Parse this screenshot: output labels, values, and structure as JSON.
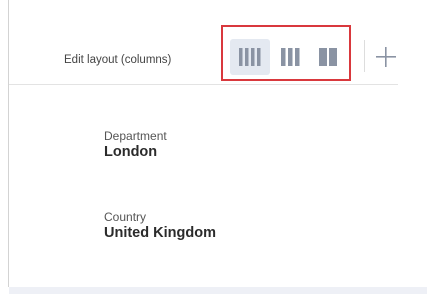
{
  "toolbar": {
    "edit_layout_label": "Edit layout (columns)",
    "layout_options": [
      {
        "name": "four-columns",
        "bars": 4,
        "selected": true
      },
      {
        "name": "three-columns",
        "bars": 3,
        "selected": false
      },
      {
        "name": "two-columns",
        "bars": 2,
        "selected": false
      }
    ],
    "add_icon": "plus-icon"
  },
  "fields": {
    "department": {
      "label": "Department",
      "value": "London"
    },
    "country": {
      "label": "Country",
      "value": "United Kingdom"
    }
  },
  "colors": {
    "highlight": "#d9383d",
    "icon_gray": "#8a93a3",
    "active_button_bg": "#e4e9f1"
  }
}
